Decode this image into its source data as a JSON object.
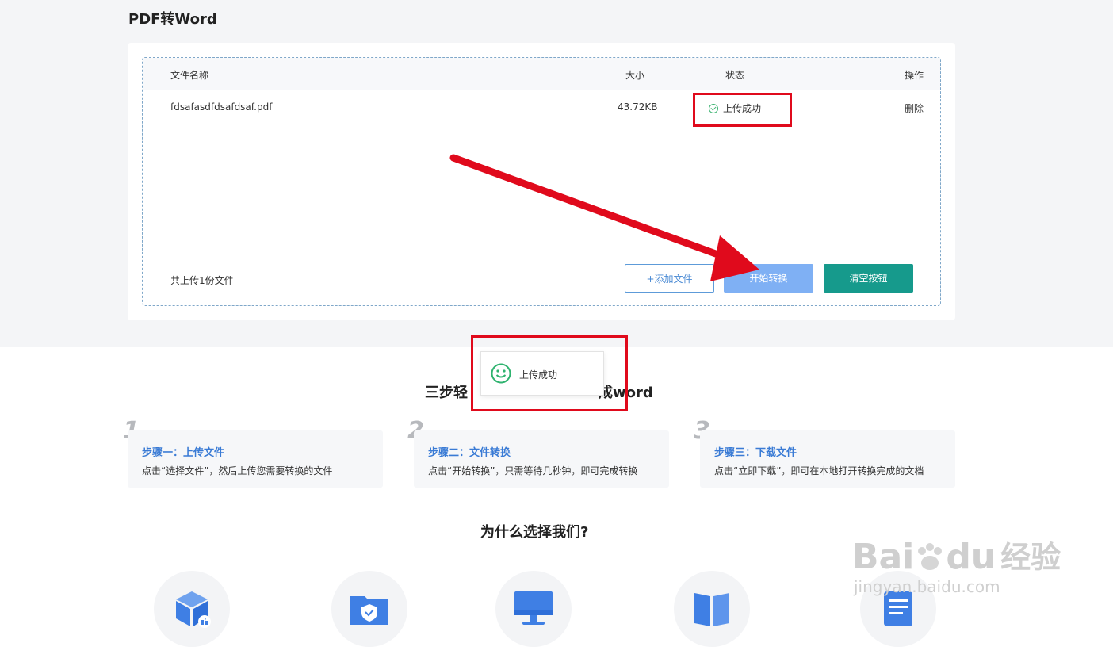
{
  "page": {
    "title": "PDF转Word"
  },
  "table": {
    "headers": {
      "name": "文件名称",
      "size": "大小",
      "status": "状态",
      "action": "操作"
    },
    "rows": [
      {
        "name": "fdsafasdfdsafdsaf.pdf",
        "size": "43.72KB",
        "status": "上传成功",
        "action": "删除"
      }
    ],
    "count_text": "共上传1份文件"
  },
  "buttons": {
    "add": "+添加文件",
    "start": "开始转换",
    "clear": "清空按钮"
  },
  "toast": {
    "text": "上传成功"
  },
  "steps": {
    "title_left": "三步轻",
    "title_right": "成word",
    "items": [
      {
        "num": "1",
        "title": "步骤一：上传文件",
        "desc": "点击“选择文件”，然后上传您需要转换的文件"
      },
      {
        "num": "2",
        "title": "步骤二：文件转换",
        "desc": "点击“开始转换”，只需等待几秒钟，即可完成转换"
      },
      {
        "num": "3",
        "title": "步骤三：下载文件",
        "desc": "点击“立即下载”，即可在本地打开转换完成的文档"
      }
    ]
  },
  "why": {
    "title": "为什么选择我们?"
  },
  "watermark": {
    "brand_a": "Bai",
    "brand_b": "du",
    "brand_c": "经验",
    "url": "jingyan.baidu.com"
  },
  "colors": {
    "accent": "#3a7bd5",
    "start_button": "#7fb0f4",
    "clear_button": "#169a8c",
    "success": "#3cb371",
    "annotation_red": "#e00a1c"
  }
}
